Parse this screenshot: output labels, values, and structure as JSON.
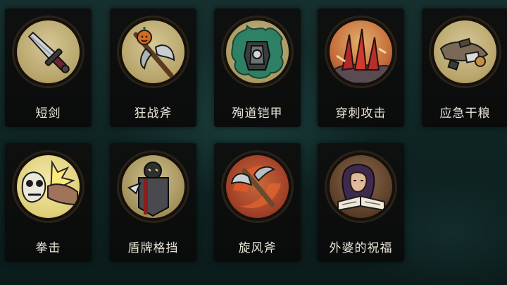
{
  "cards": [
    {
      "name": "短剑",
      "icon": "dagger-icon"
    },
    {
      "name": "狂战斧",
      "icon": "berserker-axe-icon"
    },
    {
      "name": "殉道铠甲",
      "icon": "martyr-armor-icon"
    },
    {
      "name": "穿刺攻击",
      "icon": "spike-attack-icon"
    },
    {
      "name": "应急干粮",
      "icon": "rations-icon"
    },
    {
      "name": "拳击",
      "icon": "punch-icon"
    },
    {
      "name": "盾牌格挡",
      "icon": "shield-block-icon"
    },
    {
      "name": "旋风斧",
      "icon": "whirlwind-axe-icon"
    },
    {
      "name": "外婆的祝福",
      "icon": "grandma-blessing-icon"
    }
  ],
  "colors": {
    "medal_fill": "#c9b57f",
    "label_text": "#e9e4d6",
    "card_bg": "#0e0e0e"
  }
}
